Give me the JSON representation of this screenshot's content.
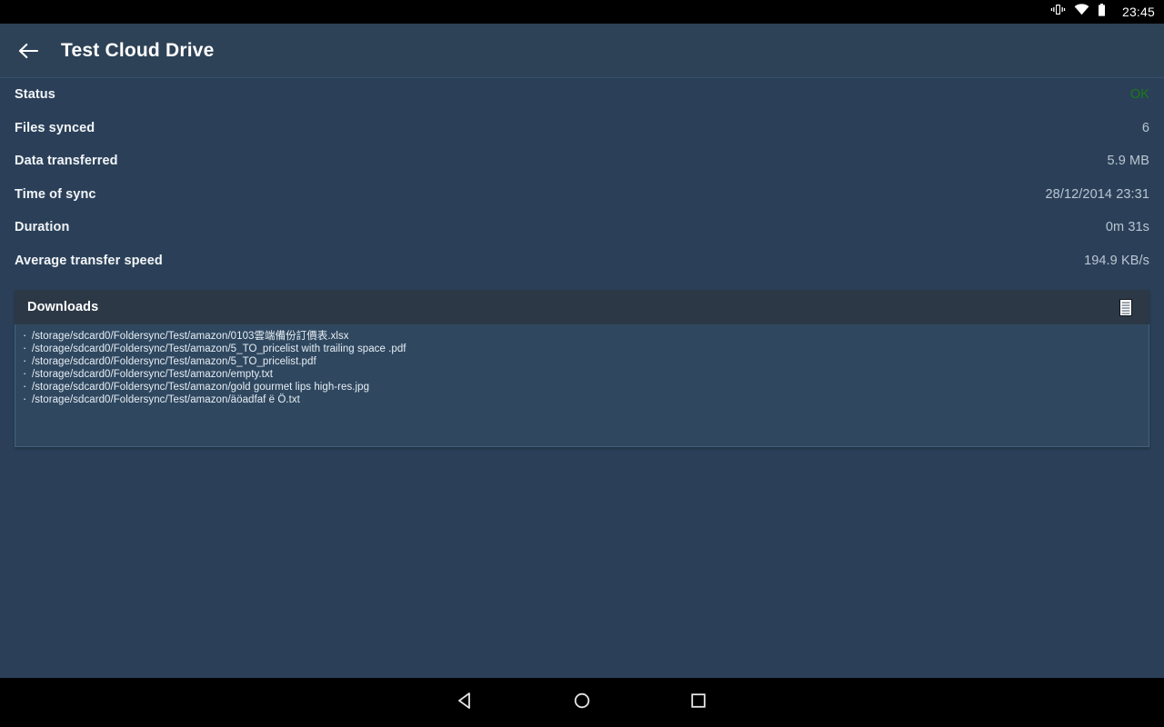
{
  "status_bar": {
    "icons": [
      "vibrate-icon",
      "wifi-icon",
      "battery-icon"
    ],
    "clock": "23:45"
  },
  "toolbar": {
    "back_icon": "back-arrow-icon",
    "title": "Test Cloud Drive"
  },
  "stats": [
    {
      "label": "Status",
      "value": "OK",
      "value_color": "#1a7a1a",
      "is_ok": true
    },
    {
      "label": "Files synced",
      "value": "6",
      "value_color": "#b9c6d2",
      "is_ok": false
    },
    {
      "label": "Data transferred",
      "value": "5.9 MB",
      "value_color": "#b9c6d2",
      "is_ok": false
    },
    {
      "label": "Time of sync",
      "value": "28/12/2014 23:31",
      "value_color": "#b9c6d2",
      "is_ok": false
    },
    {
      "label": "Duration",
      "value": "0m 31s",
      "value_color": "#b9c6d2",
      "is_ok": false
    },
    {
      "label": "Average transfer speed",
      "value": "194.9 KB/s",
      "value_color": "#b9c6d2",
      "is_ok": false
    }
  ],
  "downloads_card": {
    "title": "Downloads",
    "action_icon": "document-list-icon",
    "files": [
      "/storage/sdcard0/Foldersync/Test/amazon/0103雲端備份訂價表.xlsx",
      "/storage/sdcard0/Foldersync/Test/amazon/5_TO_pricelist with trailing space .pdf",
      "/storage/sdcard0/Foldersync/Test/amazon/5_TO_pricelist.pdf",
      "/storage/sdcard0/Foldersync/Test/amazon/empty.txt",
      "/storage/sdcard0/Foldersync/Test/amazon/gold gourmet lips high-res.jpg",
      "/storage/sdcard0/Foldersync/Test/amazon/äöadfaf ë Ö.txt"
    ]
  },
  "nav_bar": {
    "buttons": [
      {
        "name": "back-nav-button",
        "icon": "triangle-left-icon"
      },
      {
        "name": "home-nav-button",
        "icon": "circle-icon"
      },
      {
        "name": "recents-nav-button",
        "icon": "square-icon"
      }
    ]
  },
  "colors": {
    "page_background": "#2b4058",
    "toolbar_background": "#2e4257",
    "card_header_background": "#2c3846",
    "card_body_background": "#2f4860",
    "card_border": "#44627f",
    "label_text": "#f2f5f8",
    "value_text": "#b9c6d2",
    "accent_ok": "#1a7a1a",
    "system_bar": "#000000"
  }
}
